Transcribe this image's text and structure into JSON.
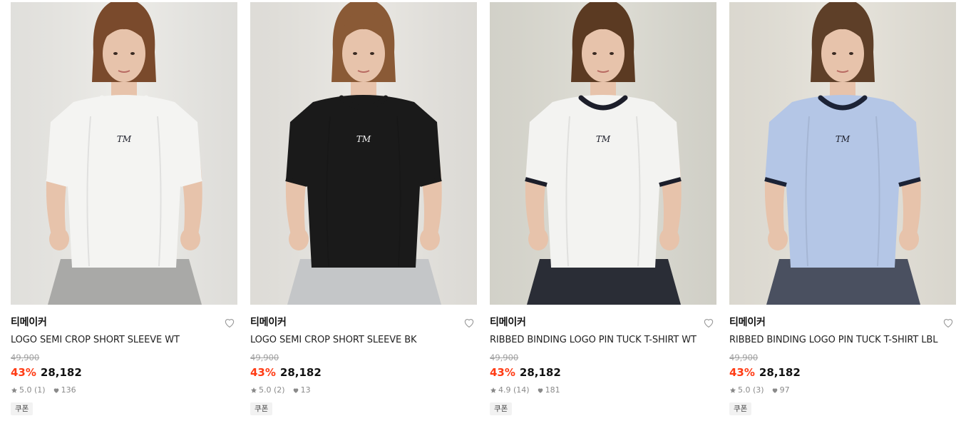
{
  "products": [
    {
      "brand": "티메이커",
      "name": "LOGO SEMI CROP SHORT SLEEVE WT",
      "original_price": "49,900",
      "discount": "43%",
      "price": "28,182",
      "rating": "5.0 (1)",
      "likes": "136",
      "badge": "쿠폰",
      "image": {
        "bg": "#ecebe7",
        "shirt": "#f4f4f2",
        "trim": "#f4f4f2",
        "hair": "#7a4a2c",
        "pants": "#a9a9a7"
      }
    },
    {
      "brand": "티메이커",
      "name": "LOGO SEMI CROP SHORT SLEEVE BK",
      "original_price": "49,900",
      "discount": "43%",
      "price": "28,182",
      "rating": "5.0 (2)",
      "likes": "13",
      "badge": "쿠폰",
      "image": {
        "bg": "#e9e7e2",
        "shirt": "#1a1a1a",
        "trim": "#1a1a1a",
        "hair": "#8a5a36",
        "pants": "#c4c6c8"
      }
    },
    {
      "brand": "티메이커",
      "name": "RIBBED BINDING LOGO PIN TUCK T-SHIRT WT",
      "original_price": "49,900",
      "discount": "43%",
      "price": "28,182",
      "rating": "4.9 (14)",
      "likes": "181",
      "badge": "쿠폰",
      "image": {
        "bg": "#dddcd3",
        "shirt": "#f3f3f1",
        "trim": "#1c1e2a",
        "hair": "#5b3a22",
        "pants": "#2a2d36"
      }
    },
    {
      "brand": "티메이커",
      "name": "RIBBED BINDING LOGO PIN TUCK T-SHIRT LBL",
      "original_price": "49,900",
      "discount": "43%",
      "price": "28,182",
      "rating": "5.0 (3)",
      "likes": "97",
      "badge": "쿠폰",
      "image": {
        "bg": "#e6e3da",
        "shirt": "#b4c6e6",
        "trim": "#1c2336",
        "hair": "#5e3f28",
        "pants": "#4a5060"
      }
    }
  ],
  "icons": {
    "wishlist": "heart-outline-icon",
    "rating": "star-icon",
    "likes": "heart-filled-icon"
  },
  "colors": {
    "discount": "#ff3b14",
    "muted": "#8a8a8a",
    "badge_bg": "#f2f2f2"
  }
}
